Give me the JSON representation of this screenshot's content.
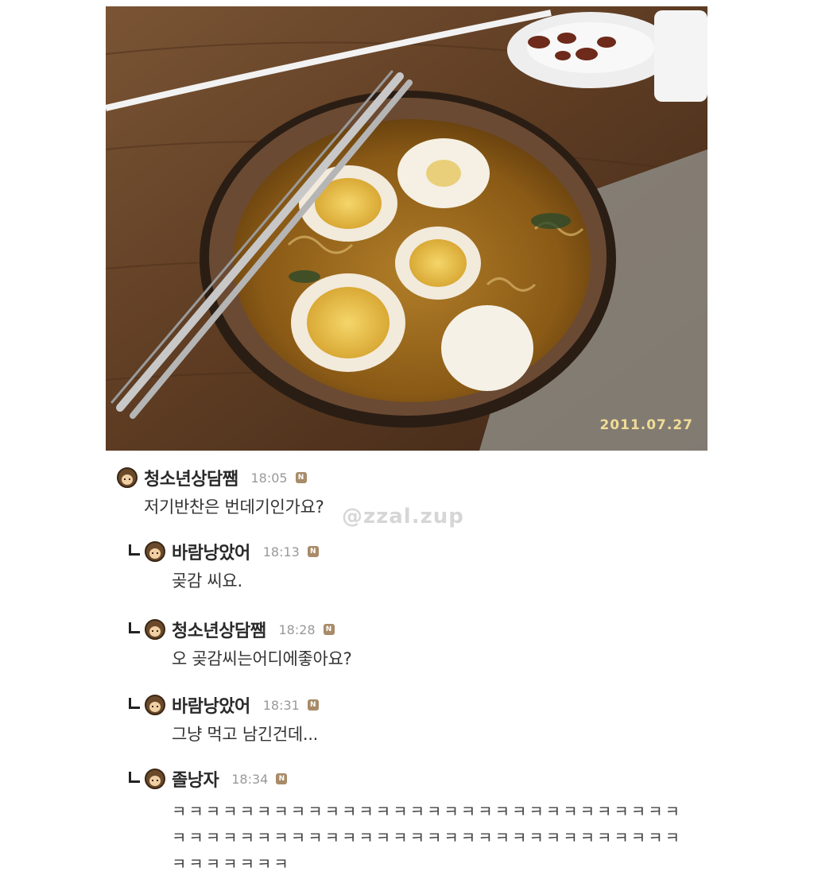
{
  "photo": {
    "date_stamp": "2011.07.27"
  },
  "watermark": "@zzal.zup",
  "comments": [
    {
      "nick": "청소년상담쨈",
      "time": "18:05",
      "badge": "N",
      "text": "저기반찬은 번데기인가요?",
      "is_reply": false
    },
    {
      "nick": "바람낭았어",
      "time": "18:13",
      "badge": "N",
      "text": "곶감 씨요.",
      "is_reply": true
    },
    {
      "nick": "청소년상담쨈",
      "time": "18:28",
      "badge": "N",
      "text": "오 곶감씨는어디에좋아요?",
      "is_reply": true
    },
    {
      "nick": "바람낭았어",
      "time": "18:31",
      "badge": "N",
      "text": "그냥 먹고 남긴건데...",
      "is_reply": true
    },
    {
      "nick": "졸낭자",
      "time": "18:34",
      "badge": "N",
      "text": "ㅋㅋㅋㅋㅋㅋㅋㅋㅋㅋㅋㅋㅋㅋㅋㅋㅋㅋㅋㅋㅋㅋㅋㅋㅋㅋㅋㅋㅋㅋㅋㅋㅋㅋㅋㅋㅋㅋㅋㅋㅋㅋㅋㅋㅋㅋㅋㅋㅋㅋㅋㅋㅋㅋㅋㅋㅋㅋㅋㅋㅋㅋㅋㅋㅋㅋㅋ",
      "is_reply": true
    }
  ],
  "colors": {
    "table_wood": "#5a3a22",
    "broth": "#9a6a1c",
    "bowl_rim": "#2a1d14",
    "date_stamp": "#f0dc96"
  }
}
